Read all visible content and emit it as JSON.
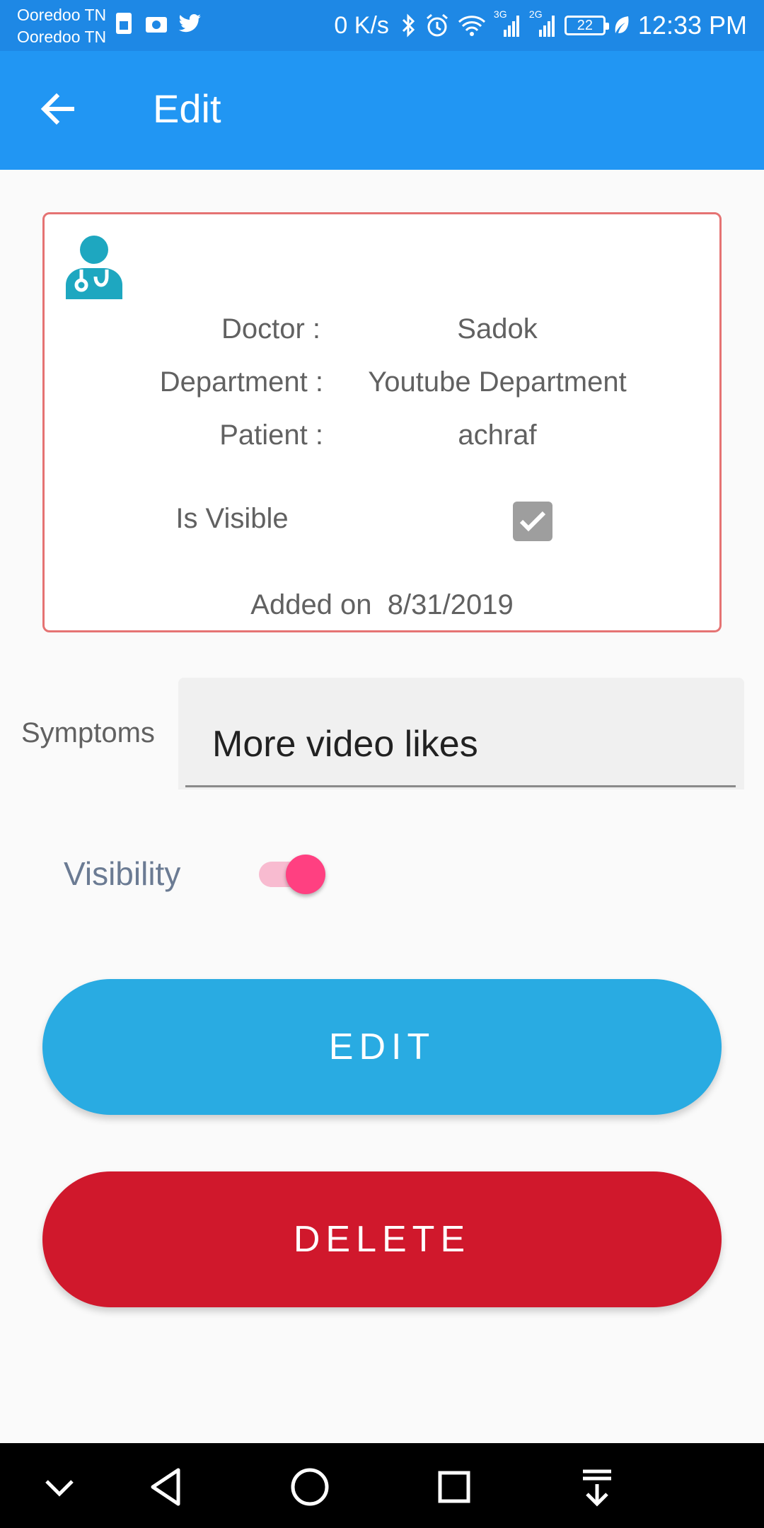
{
  "status_bar": {
    "carrier_1": "Ooredoo TN",
    "carrier_2": "Ooredoo TN",
    "net_speed": "0 K/s",
    "network_1": "3G",
    "network_2": "2G",
    "battery": "22",
    "time": "12:33 PM",
    "icons_left": [
      "sim-card-icon",
      "camera-icon",
      "twitter-icon"
    ],
    "icons_right": [
      "bluetooth-icon",
      "alarm-icon",
      "wifi-icon",
      "signal-icon",
      "signal-icon",
      "battery-icon",
      "leaf-icon"
    ]
  },
  "app_bar": {
    "title": "Edit",
    "back_icon": "arrow-back-icon",
    "color": "#2196f3"
  },
  "card": {
    "icon": "doctor-icon",
    "doctor_label": "Doctor :",
    "doctor_value": "Sadok",
    "department_label": "Department :",
    "department_value": "Youtube Department",
    "patient_label": "Patient :",
    "patient_value": "achraf",
    "visible_label": "Is Visible",
    "visible_checked": true,
    "added_label": "Added on",
    "added_date": "8/31/2019",
    "border_color": "#e57373"
  },
  "form": {
    "symptoms_label": "Symptoms",
    "symptoms_value": "More video likes",
    "visibility_label": "Visibility",
    "visibility_on": true
  },
  "buttons": {
    "edit_label": "EDIT",
    "edit_color": "#29abe2",
    "delete_label": "DELETE",
    "delete_color": "#d0182c"
  },
  "nav_bar": {
    "icons": [
      "chevron-down-icon",
      "back-triangle-icon",
      "home-circle-icon",
      "recents-square-icon",
      "notifications-pull-icon"
    ]
  }
}
